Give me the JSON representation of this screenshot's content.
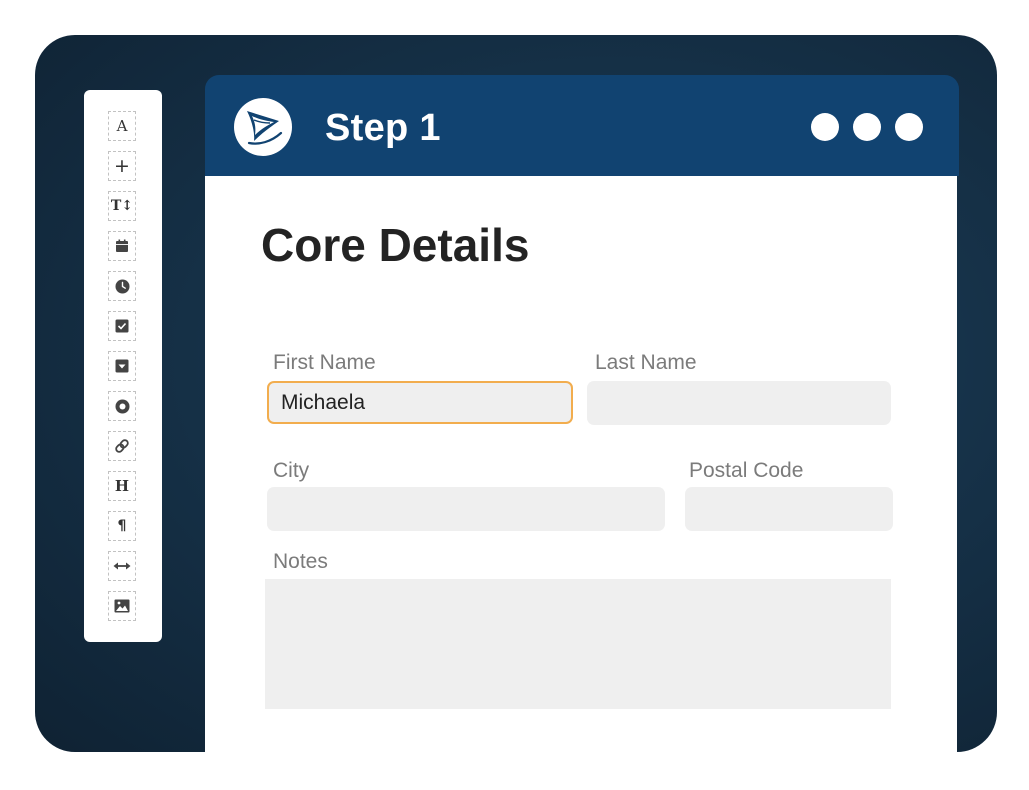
{
  "header": {
    "title": "Step 1",
    "logo_icon": "paper-plane-logo-icon",
    "window_controls": [
      "dot-icon",
      "dot-icon",
      "dot-icon"
    ],
    "color": "#114371"
  },
  "toolbox": {
    "tools": [
      {
        "name": "text-tool",
        "icon": "letter-a-icon",
        "glyph": "A"
      },
      {
        "name": "add-tool",
        "icon": "plus-icon",
        "glyph": "+"
      },
      {
        "name": "font-size-tool",
        "icon": "text-size-icon",
        "glyph": "T↕"
      },
      {
        "name": "date-tool",
        "icon": "calendar-icon"
      },
      {
        "name": "time-tool",
        "icon": "clock-icon"
      },
      {
        "name": "checkbox-tool",
        "icon": "checkbox-icon"
      },
      {
        "name": "dropdown-tool",
        "icon": "dropdown-icon"
      },
      {
        "name": "radio-tool",
        "icon": "radio-icon"
      },
      {
        "name": "link-tool",
        "icon": "link-icon"
      },
      {
        "name": "heading-tool",
        "icon": "heading-icon",
        "glyph": "H"
      },
      {
        "name": "paragraph-tool",
        "icon": "paragraph-icon",
        "glyph": "¶"
      },
      {
        "name": "divider-tool",
        "icon": "arrows-horizontal-icon"
      },
      {
        "name": "image-tool",
        "icon": "image-icon"
      }
    ]
  },
  "form": {
    "title": "Core Details",
    "first_name": {
      "label": "First Name",
      "value": "Michaela"
    },
    "last_name": {
      "label": "Last Name",
      "value": ""
    },
    "city": {
      "label": "City",
      "value": ""
    },
    "postal_code": {
      "label": "Postal Code",
      "value": ""
    },
    "notes": {
      "label": "Notes",
      "value": ""
    },
    "focus_color": "#f2ad4e"
  }
}
